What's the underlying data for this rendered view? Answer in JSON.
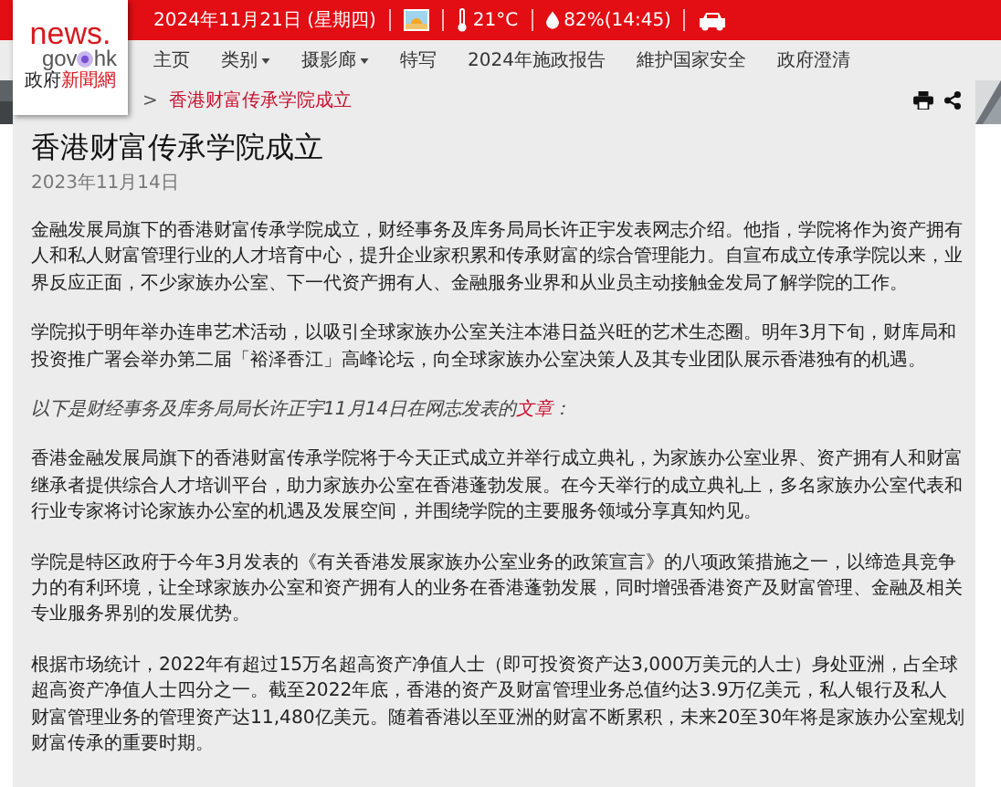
{
  "topbar": {
    "date": "2024年11月21日 (星期四)",
    "temperature": "21°C",
    "humidity": "82%(14:45)"
  },
  "logo": {
    "line1": "news.",
    "line2_left": "gov",
    "line2_right": "hk",
    "line3_plain": "政府",
    "line3_accent": "新聞網"
  },
  "nav": [
    {
      "label": "主页",
      "has_menu": false
    },
    {
      "label": "类别",
      "has_menu": true
    },
    {
      "label": "摄影廊",
      "has_menu": true
    },
    {
      "label": "特写",
      "has_menu": false
    },
    {
      "label": "2024年施政报告",
      "has_menu": false
    },
    {
      "label": "維护国家安全",
      "has_menu": false
    },
    {
      "label": "政府澄清",
      "has_menu": false
    }
  ],
  "breadcrumb": {
    "separator": ">",
    "current": "香港财富传承学院成立"
  },
  "article": {
    "title": "香港财富传承学院成立",
    "date": "2023年11月14日",
    "paragraphs": [
      {
        "kind": "text",
        "text": "金融发展局旗下的香港财富传承学院成立，财经事务及库务局局长许正宇发表网志介绍。他指，学院将作为资产拥有人和私人财富管理行业的人才培育中心，提升企业家积累和传承财富的综合管理能力。自宣布成立传承学院以来，业界反应正面，不少家族办公室、下一代资产拥有人、金融服务业界和从业员主动接触金发局了解学院的工作。"
      },
      {
        "kind": "text",
        "text": "学院拟于明年举办连串艺术活动，以吸引全球家族办公室关注本港日益兴旺的艺术生态圈。明年3月下旬，财库局和投资推广署会举办第二届「裕泽香江」高峰论坛，向全球家族办公室决策人及其专业团队展示香港独有的机遇。"
      },
      {
        "kind": "intro",
        "text": "以下是财经事务及库务局局长许正宇11月14日在网志发表的",
        "link": "文章",
        "suffix": "："
      },
      {
        "kind": "text",
        "text": "香港金融发展局旗下的香港财富传承学院将于今天正式成立并举行成立典礼，为家族办公室业界、资产拥有人和财富继承者提供综合人才培训平台，助力家族办公室在香港蓬勃发展。在今天举行的成立典礼上，多名家族办公室代表和行业专家将讨论家族办公室的机遇及发展空间，并围绕学院的主要服务领域分享真知灼见。"
      },
      {
        "kind": "text",
        "text": "学院是特区政府于今年3月发表的《有关香港发展家族办公室业务的政策宣言》的八项政策措施之一，以缔造具竞争力的有利环境，让全球家族办公室和资产拥有人的业务在香港蓬勃发展，同时增强香港资产及财富管理、金融及相关专业服务界别的发展优势。"
      },
      {
        "kind": "text",
        "text": "根据市场统计，2022年有超过15万名超高资产净值人士（即可投资资产达3,000万美元的人士）身处亚洲，占全球超高资产净值人士四分之一。截至2022年底，香港的资产及财富管理业务总值约达3.9万亿美元，私人银行及私人财富管理业务的管理资产达11,480亿美元。随着香港以至亚洲的财富不断累积，未来20至30年将是家族办公室规划财富传承的重要时期。"
      }
    ]
  }
}
